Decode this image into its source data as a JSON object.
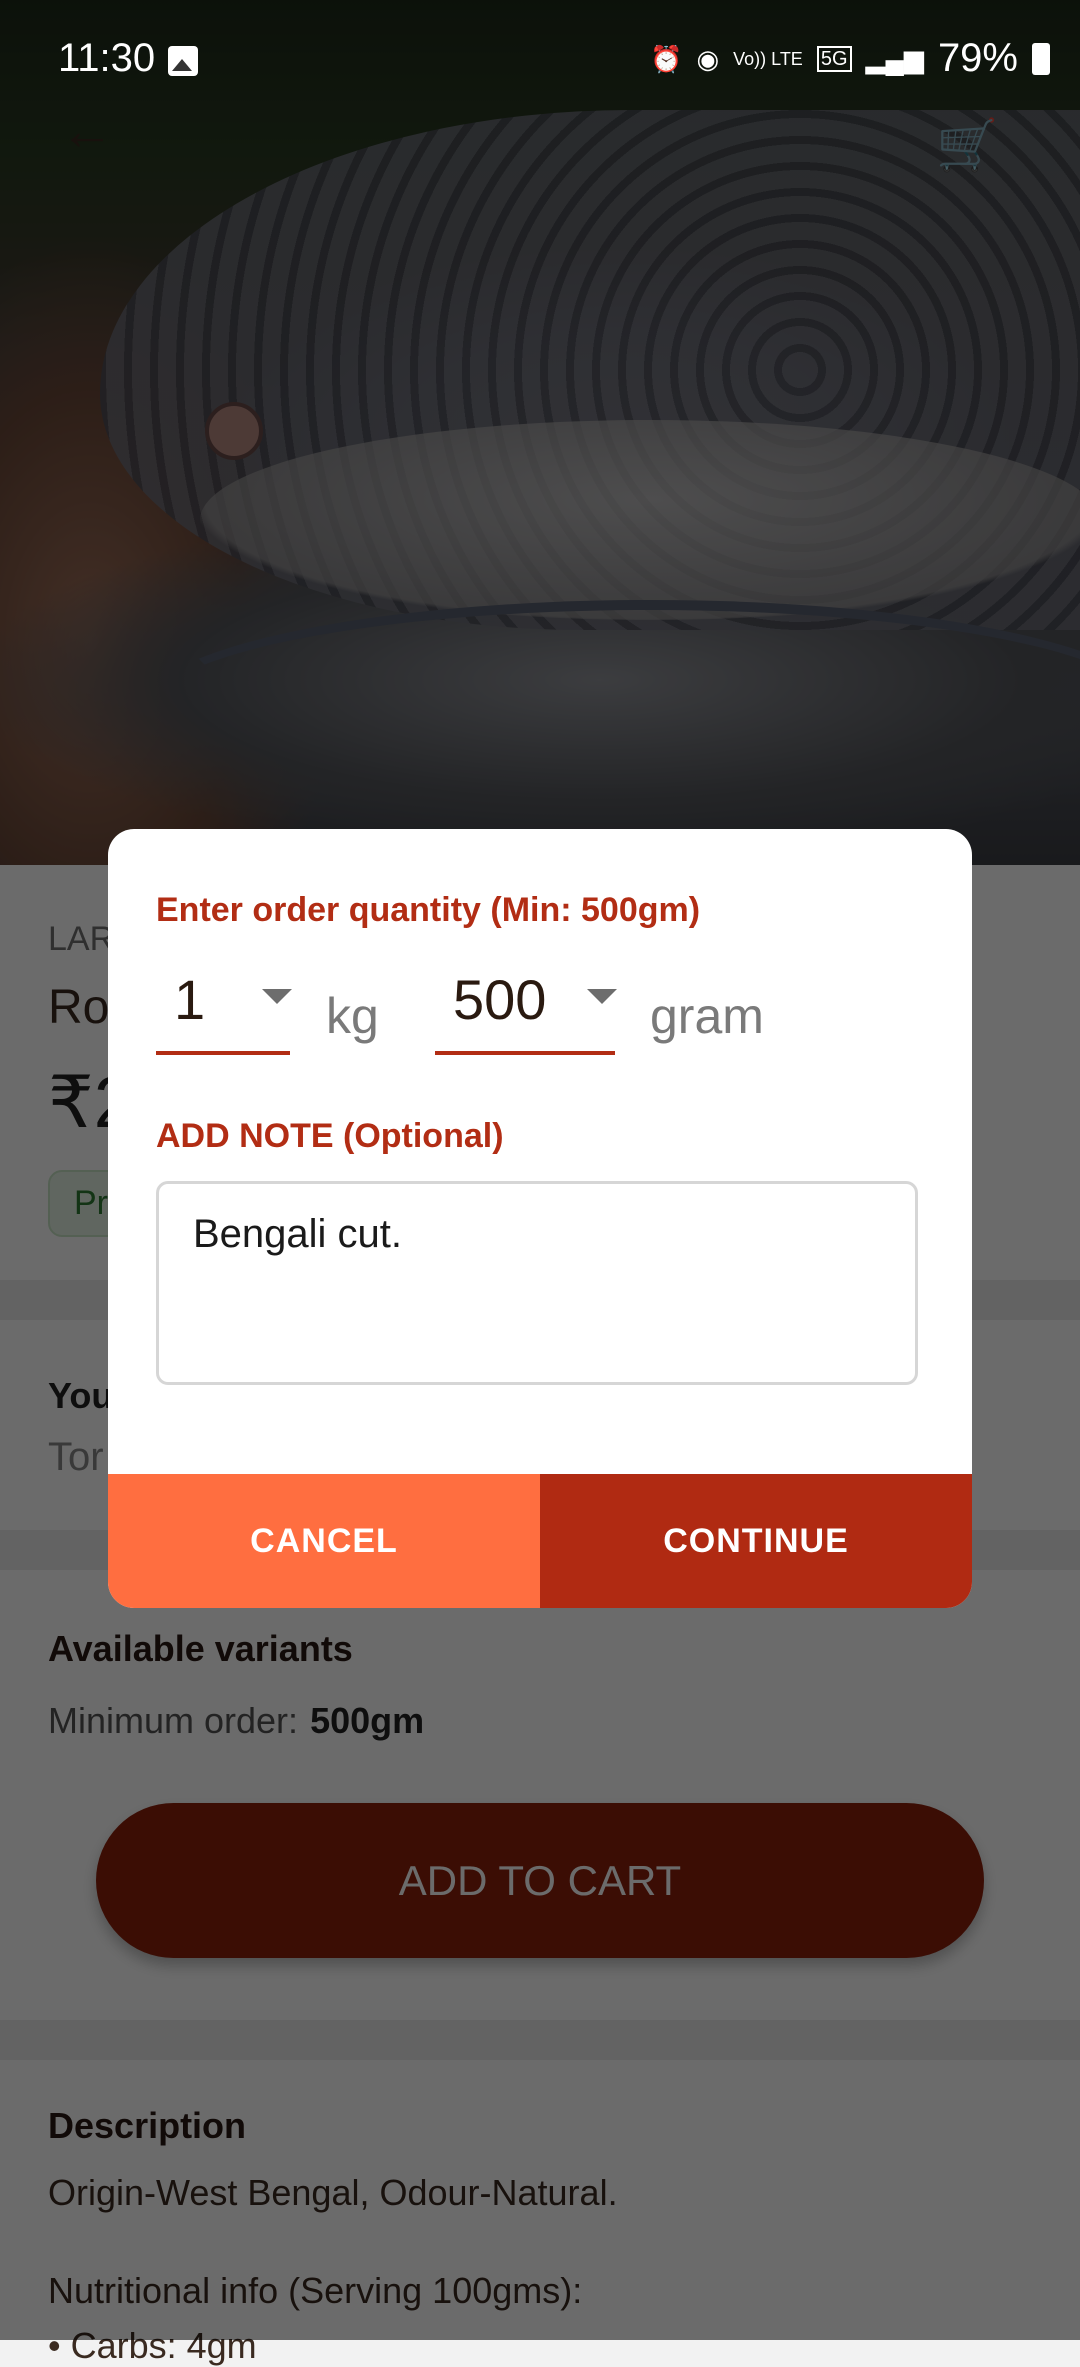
{
  "status_bar": {
    "time": "11:30",
    "icons": [
      "gallery-icon",
      "alarm-icon",
      "hotspot-icon",
      "volte-icon",
      "5g-icon",
      "signal-icon"
    ],
    "volte_label": "Vo)) LTE",
    "network_label": "5G",
    "battery": "79%"
  },
  "header": {
    "back_icon": "←",
    "cart_icon": "🛒"
  },
  "product": {
    "category_partial": "LAR",
    "name_partial": "Ro",
    "price_partial": "₹2",
    "badge_partial": "Pr",
    "you_partial": "You",
    "tor_partial": "Tor",
    "variants_heading": "Available variants",
    "min_order_label": "Minimum order:",
    "min_order_value": "500gm",
    "add_to_cart": "ADD TO CART",
    "description_heading": "Description",
    "description": "Origin-West Bengal, Odour-Natural.",
    "nutrition_heading": "Nutritional info (Serving 100gms):",
    "nutrition_first": "• Carbs: 4gm"
  },
  "dialog": {
    "quantity_title": "Enter order quantity (Min: 500gm)",
    "kg_value": "1",
    "kg_unit": "kg",
    "gram_value": "500",
    "gram_unit": "gram",
    "note_title": "ADD NOTE (Optional)",
    "note_value": "Bengali cut.",
    "cancel_label": "CANCEL",
    "continue_label": "CONTINUE"
  },
  "colors": {
    "accent_red": "#b02a12",
    "cancel_orange": "#ff6e40",
    "add_to_cart_bg": "#8d1f0b",
    "badge_green": "#2e7d32"
  }
}
